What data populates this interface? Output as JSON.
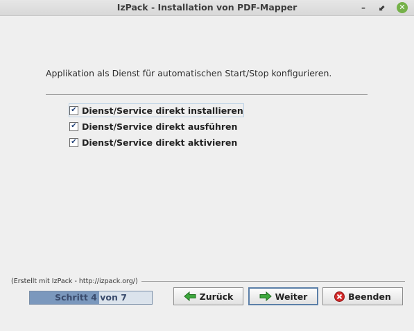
{
  "window": {
    "title": "IzPack - Installation von  PDF-Mapper",
    "minimize_glyph": "–",
    "maximize_glyph": "⬋",
    "close_glyph": "✕"
  },
  "panel": {
    "description": "Applikation als Dienst für automatischen Start/Stop konfigurieren.",
    "options": [
      {
        "label": "Dienst/Service direkt installieren",
        "checked": true
      },
      {
        "label": "Dienst/Service direkt ausführen",
        "checked": true
      },
      {
        "label": "Dienst/Service direkt aktivieren",
        "checked": true
      }
    ]
  },
  "footer": {
    "credits": "(Erstellt mit IzPack - http://izpack.org/)",
    "progress_text": "Schritt 4 von 7",
    "progress_fraction": 0.571,
    "back_label": "Zurück",
    "next_label": "Weiter",
    "quit_label": "Beenden"
  },
  "colors": {
    "back_icon": "#3da83d",
    "next_icon": "#3da83d",
    "quit_icon": "#d42a2a"
  }
}
